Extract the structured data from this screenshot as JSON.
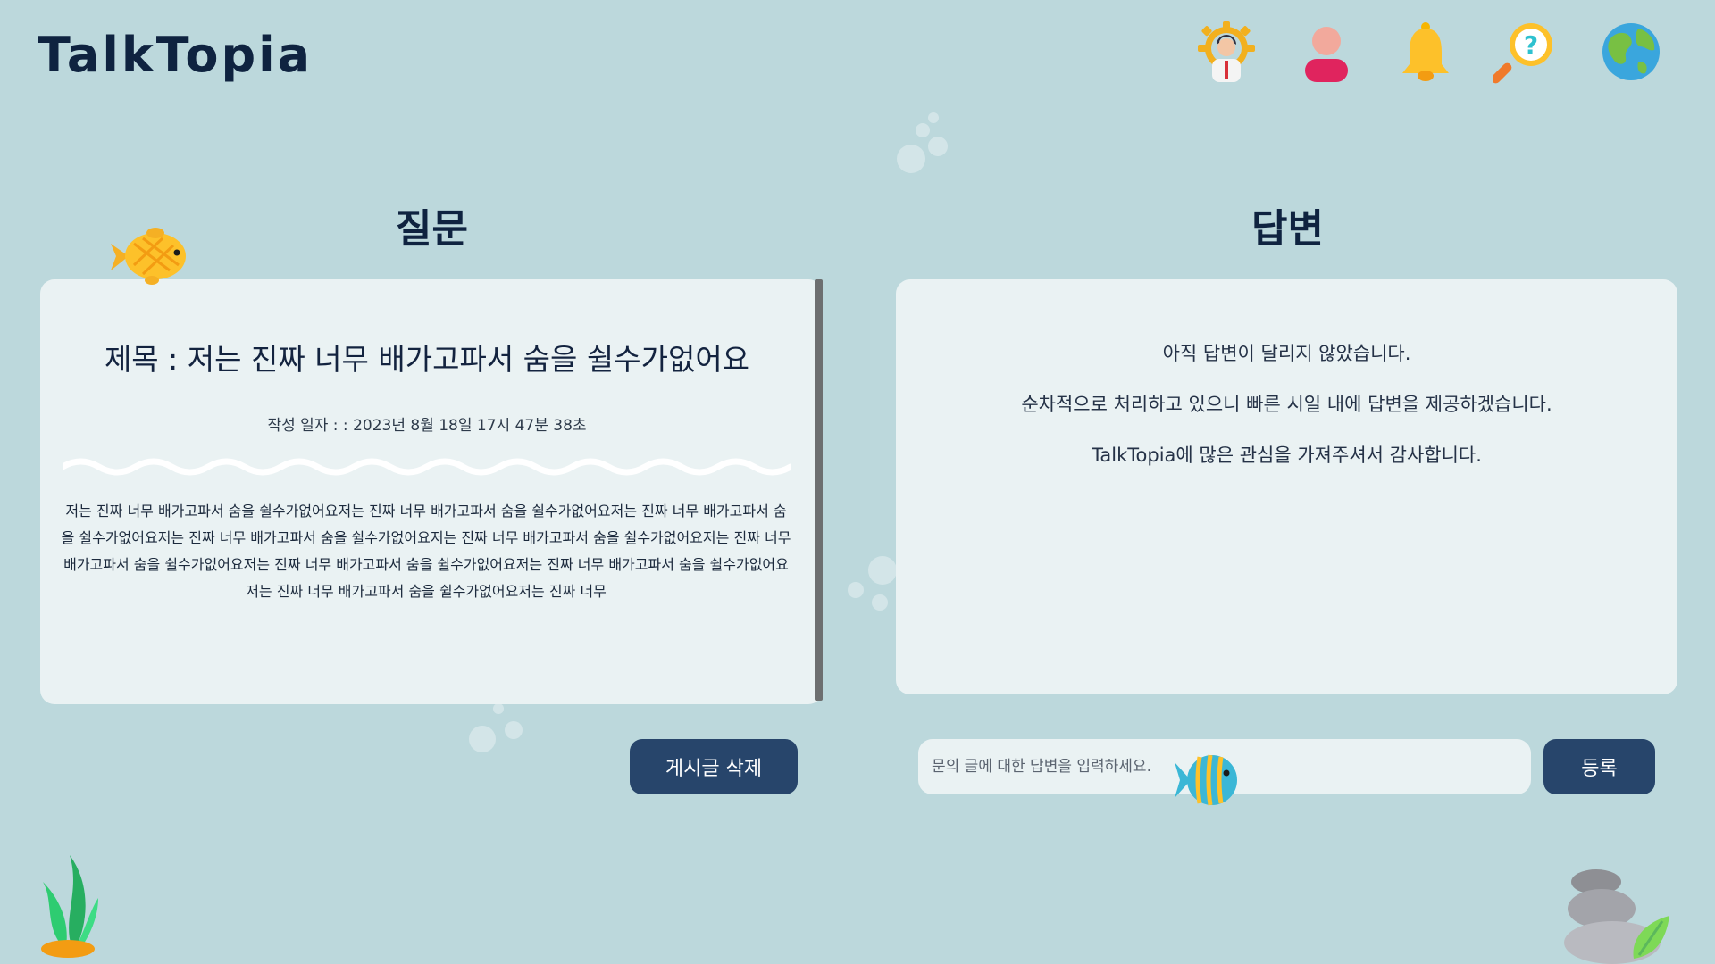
{
  "header": {
    "logo": "TalkTopia",
    "nav": [
      {
        "name": "admin-icon"
      },
      {
        "name": "profile-icon"
      },
      {
        "name": "bell-icon"
      },
      {
        "name": "help-search-icon"
      },
      {
        "name": "globe-icon"
      }
    ]
  },
  "question": {
    "section_title": "질문",
    "title": "제목 : 저는 진짜 너무 배가고파서 숨을 쉴수가없어요",
    "date": "작성 일자 : : 2023년 8월 18일 17시 47분 38초",
    "body": "저는 진짜 너무 배가고파서 숨을 쉴수가없어요저는 진짜 너무 배가고파서 숨을 쉴수가없어요저는 진짜 너무 배가고파서 숨을 쉴수가없어요저는 진짜 너무 배가고파서 숨을 쉴수가없어요저는 진짜 너무 배가고파서 숨을 쉴수가없어요저는 진짜 너무 배가고파서 숨을 쉴수가없어요저는 진짜 너무 배가고파서 숨을 쉴수가없어요저는 진짜 너무 배가고파서 숨을 쉴수가없어요저는 진짜 너무 배가고파서 숨을 쉴수가없어요저는 진짜 너무",
    "delete_label": "게시글 삭제"
  },
  "answer": {
    "section_title": "답변",
    "lines": [
      "아직 답변이 달리지 않았습니다.",
      "순차적으로 처리하고 있으니 빠른 시일 내에 답변을 제공하겠습니다.",
      "TalkTopia에 많은 관심을 가져주셔서 감사합니다."
    ],
    "input_placeholder": "문의 글에 대한 답변을 입력하세요.",
    "submit_label": "등록"
  },
  "colors": {
    "background": "#bcd8dc",
    "card": "#eaf2f3",
    "button": "#27456b",
    "text": "#0f2340"
  }
}
